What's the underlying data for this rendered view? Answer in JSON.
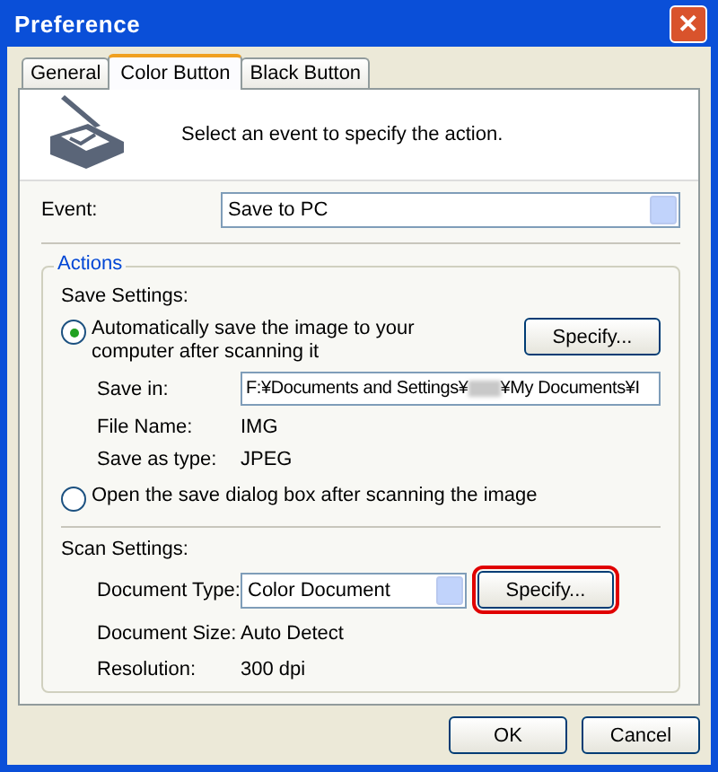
{
  "window": {
    "title": "Preference",
    "close": "✕"
  },
  "tabs": [
    {
      "label": "General",
      "selected": false
    },
    {
      "label": "Color Button",
      "selected": true
    },
    {
      "label": "Black Button",
      "selected": false
    }
  ],
  "header": {
    "text": "Select an event to specify the action."
  },
  "event": {
    "label": "Event:",
    "value": "Save to PC"
  },
  "actions": {
    "title": "Actions",
    "save_settings": {
      "title": "Save Settings:",
      "options": [
        {
          "label": "Automatically save the image to your computer after scanning it",
          "selected": true
        },
        {
          "label": "Open the save dialog box after scanning the image",
          "selected": false
        }
      ],
      "specify": {
        "label": "Specify...",
        "highlighted": false
      },
      "save_in": {
        "label": "Save in:",
        "value_start": "F:¥Documents and Settings¥",
        "value_end": "¥My Documents¥I"
      },
      "fields": [
        {
          "label": "File Name:",
          "value": "IMG"
        },
        {
          "label": "Save as type:",
          "value": "JPEG"
        }
      ]
    },
    "scan_settings": {
      "title": "Scan Settings:",
      "document_type": {
        "label": "Document Type:",
        "value": "Color Document"
      },
      "specify": {
        "label": "Specify...",
        "highlighted": true
      },
      "fields": [
        {
          "label": "Document Size:",
          "value": "Auto Detect"
        },
        {
          "label": "Resolution:",
          "value": "300 dpi"
        }
      ]
    }
  },
  "buttons": [
    "OK",
    "Cancel"
  ]
}
